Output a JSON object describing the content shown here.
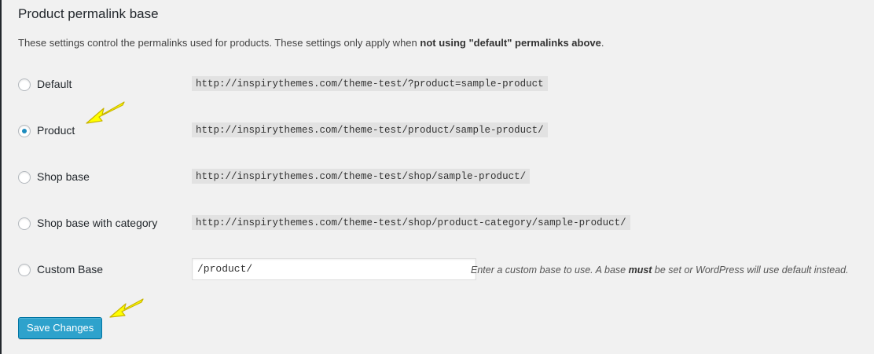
{
  "section": {
    "title": "Product permalink base",
    "description_pre": "These settings control the permalinks used for products. These settings only apply when ",
    "description_bold": "not using \"default\" permalinks above",
    "description_post": "."
  },
  "options": [
    {
      "label": "Default",
      "sample": "http://inspirythemes.com/theme-test/?product=sample-product",
      "checked": false
    },
    {
      "label": "Product",
      "sample": "http://inspirythemes.com/theme-test/product/sample-product/",
      "checked": true
    },
    {
      "label": "Shop base",
      "sample": "http://inspirythemes.com/theme-test/shop/sample-product/",
      "checked": false
    },
    {
      "label": "Shop base with category",
      "sample": "http://inspirythemes.com/theme-test/shop/product-category/sample-product/",
      "checked": false
    },
    {
      "label": "Custom Base",
      "checked": false
    }
  ],
  "custom_base": {
    "value": "/product/",
    "help_pre": "Enter a custom base to use. A base ",
    "help_bold": "must",
    "help_post": " be set or WordPress will use default instead."
  },
  "save_button": {
    "label": "Save Changes"
  },
  "annotations": {
    "arrow_color": "#ffff00",
    "arrow_icon": "yellow-pointer-arrow-icon"
  },
  "colors": {
    "accent": "#2ea2cc",
    "radio_checked": "#1e8cbe",
    "background": "#f1f1f1"
  }
}
